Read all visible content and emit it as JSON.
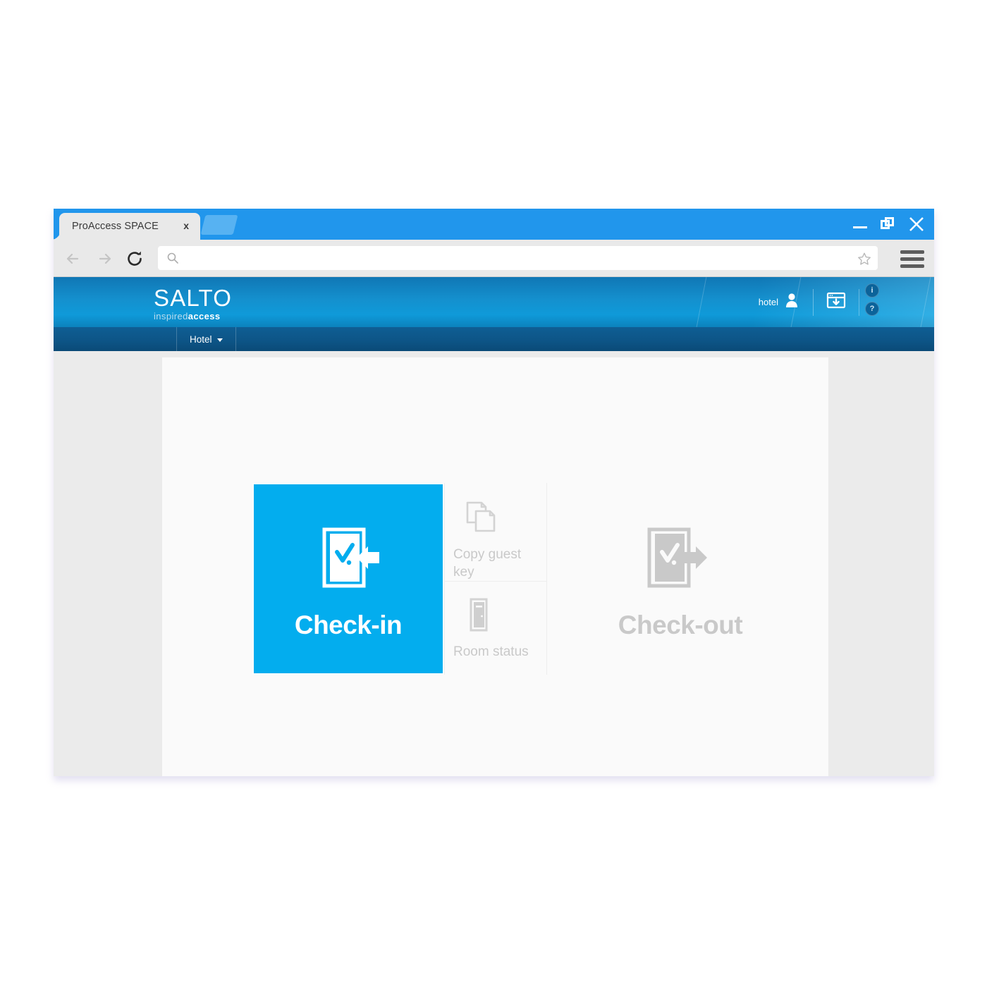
{
  "browser": {
    "tab": {
      "title": "ProAccess SPACE",
      "close_label": "x",
      "newtab_label": "new-tab"
    },
    "window_controls": {
      "minimize": "minimize",
      "maximize": "maximize",
      "close": "✕"
    },
    "toolbar": {
      "back": "back",
      "forward": "forward",
      "reload": "reload",
      "url_value": "",
      "url_placeholder": "",
      "bookmark": "bookmark",
      "menu": "menu"
    }
  },
  "app": {
    "logo": {
      "main": "SALTO",
      "sub_light": "inspired",
      "sub_bold": "access"
    },
    "header": {
      "user_label": "hotel",
      "download_icon": "download-window-icon",
      "info_icon": "i",
      "help_icon": "?"
    },
    "nav": {
      "items": [
        {
          "label": "Hotel"
        }
      ]
    },
    "tiles": {
      "primary": {
        "label": "Check-in",
        "icon": "door-check-in-icon",
        "color": "#03adee"
      },
      "column": [
        {
          "label": "Copy guest key",
          "icon": "copy-documents-icon"
        },
        {
          "label": "Room status",
          "icon": "door-icon"
        }
      ],
      "secondary": {
        "label": "Check-out",
        "icon": "door-check-out-icon",
        "color": "#c9c9c9"
      }
    }
  }
}
